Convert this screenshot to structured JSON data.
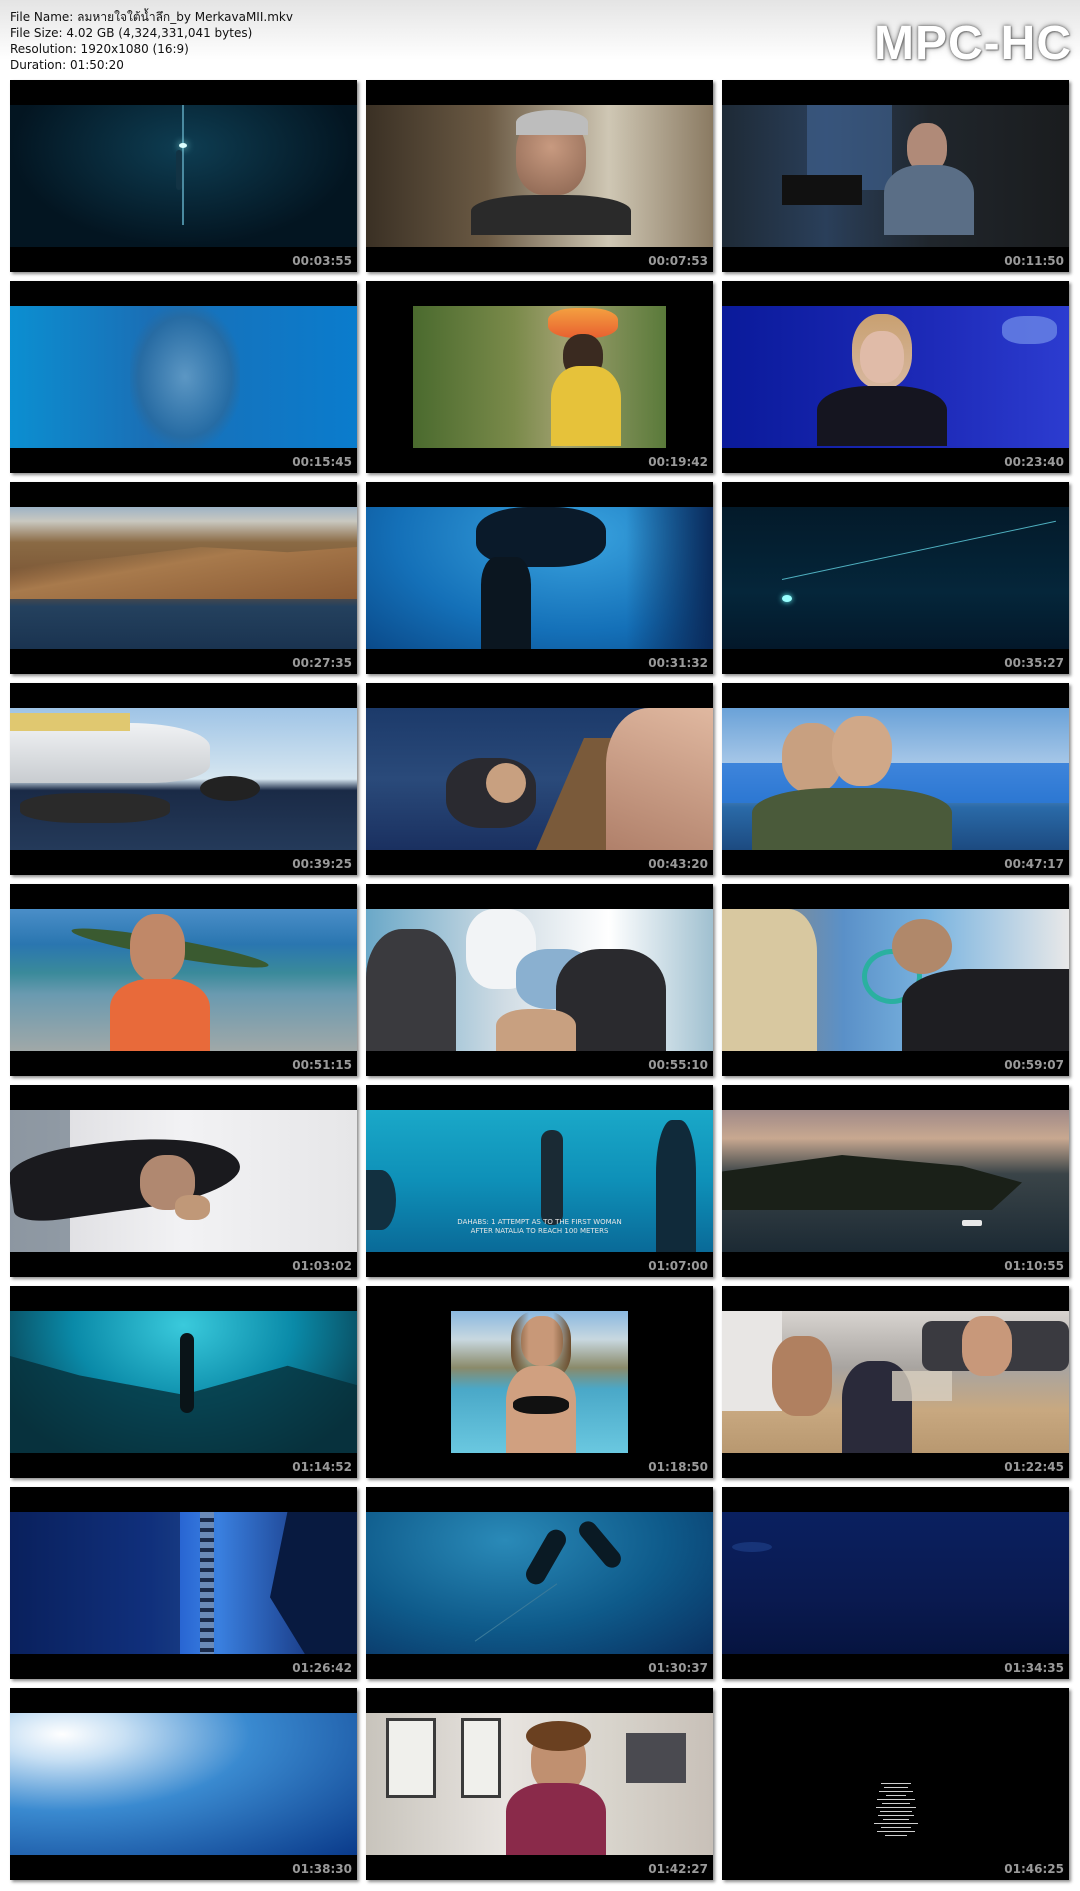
{
  "header": {
    "file_name": "File Name: ลมหายใจใต้น้ำลึก_by MerkavaMII.mkv",
    "file_size": "File Size: 4.02 GB (4,324,331,041 bytes)",
    "resolution": "Resolution: 1920x1080 (16:9)",
    "duration": "Duration: 01:50:20"
  },
  "logo": "MPC-HC",
  "thumbnails": [
    {
      "time": "00:03:55",
      "scene": "dark-deep-water-diver"
    },
    {
      "time": "00:07:53",
      "scene": "elderly-man-eyes-closed"
    },
    {
      "time": "00:11:50",
      "scene": "elderly-man-interview"
    },
    {
      "time": "00:15:45",
      "scene": "underwater-blue-blur"
    },
    {
      "time": "00:19:42",
      "scene": "woman-carrying-basket"
    },
    {
      "time": "00:23:40",
      "scene": "woman-interview-blue"
    },
    {
      "time": "00:27:35",
      "scene": "coastal-mountains"
    },
    {
      "time": "00:31:32",
      "scene": "underwater-diver-silhouette"
    },
    {
      "time": "00:35:27",
      "scene": "dark-underwater-line"
    },
    {
      "time": "00:39:25",
      "scene": "boat-and-swimmers"
    },
    {
      "time": "00:43:20",
      "scene": "divers-at-surface"
    },
    {
      "time": "00:47:17",
      "scene": "two-divers-smiling"
    },
    {
      "time": "00:51:15",
      "scene": "man-on-beach"
    },
    {
      "time": "00:55:10",
      "scene": "safety-divers-boat"
    },
    {
      "time": "00:59:07",
      "scene": "diver-oxygen-mask"
    },
    {
      "time": "01:03:02",
      "scene": "diver-lying-on-deck"
    },
    {
      "time": "01:07:00",
      "scene": "underwater-divers-subtitle",
      "subtitle": "DAHABS: 1 ATTEMPT AS TO THE FIRST WOMAN\nAFTER NATALIA TO REACH 100 METERS"
    },
    {
      "time": "01:10:55",
      "scene": "sunset-island"
    },
    {
      "time": "01:14:52",
      "scene": "underwater-cave-diver"
    },
    {
      "time": "01:18:50",
      "scene": "woman-on-beach-smiling"
    },
    {
      "time": "01:22:45",
      "scene": "people-in-living-room"
    },
    {
      "time": "01:26:42",
      "scene": "chain-underwater-arch"
    },
    {
      "time": "01:30:37",
      "scene": "divers-descending"
    },
    {
      "time": "01:34:35",
      "scene": "deep-blue-water"
    },
    {
      "time": "01:38:30",
      "scene": "light-from-surface"
    },
    {
      "time": "01:42:27",
      "scene": "woman-indoor-interview"
    },
    {
      "time": "01:46:25",
      "scene": "end-credits"
    }
  ]
}
